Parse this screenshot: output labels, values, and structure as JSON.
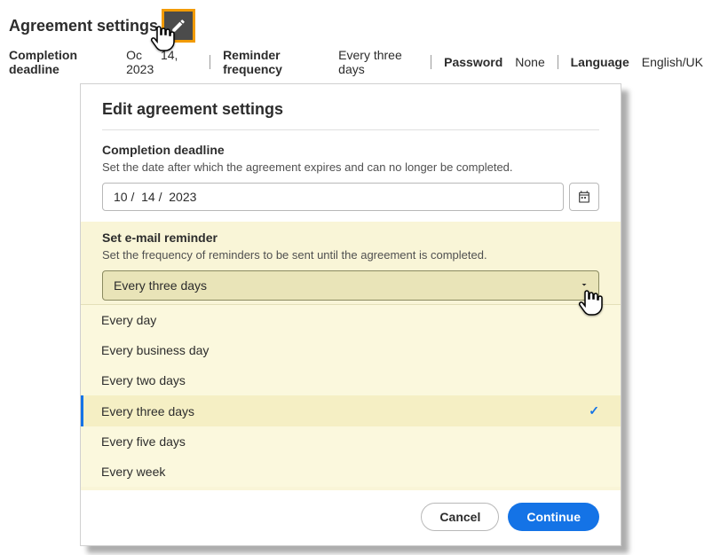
{
  "header": {
    "title": "Agreement settings",
    "edit_icon": "pencil-icon"
  },
  "info": {
    "deadline_label": "Completion deadline",
    "deadline_value_partial_a": "Oc",
    "deadline_value_partial_b": "14, 2023",
    "reminder_label": "Reminder frequency",
    "reminder_value": "Every three days",
    "password_label": "Password",
    "password_value": "None",
    "language_label": "Language",
    "language_value": "English/UK"
  },
  "dialog": {
    "title": "Edit agreement settings",
    "deadline_section_title": "Completion deadline",
    "deadline_hint": "Set the date after which the agreement expires and can no longer be completed.",
    "date_value": "10 /  14 /  2023",
    "reminder_section_title": "Set e-mail reminder",
    "reminder_hint": "Set the frequency of reminders to be sent until the agreement is completed.",
    "select_value": "Every three days",
    "options": [
      {
        "label": "Every day",
        "selected": false
      },
      {
        "label": "Every business day",
        "selected": false
      },
      {
        "label": "Every two days",
        "selected": false
      },
      {
        "label": "Every three days",
        "selected": true
      },
      {
        "label": "Every five days",
        "selected": false
      },
      {
        "label": "Every week",
        "selected": false
      }
    ],
    "cancel_label": "Cancel",
    "continue_label": "Continue"
  }
}
